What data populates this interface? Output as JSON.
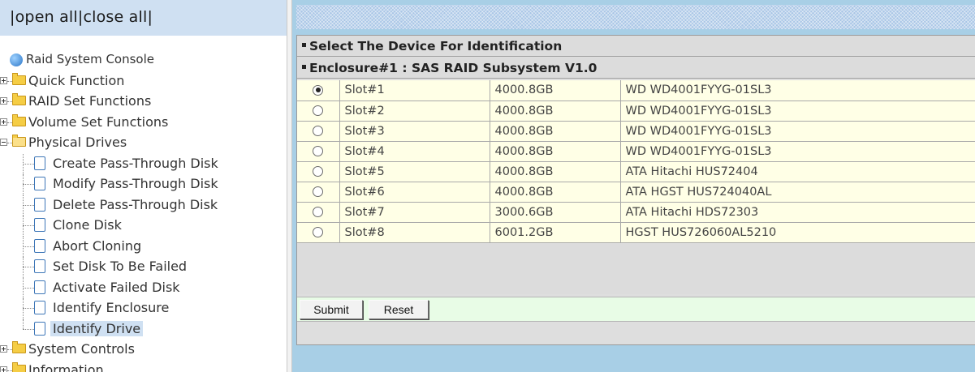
{
  "top_links": {
    "prefix": "|",
    "open_all": "open all",
    "sep": "|",
    "close_all": "close all",
    "suffix": "|"
  },
  "tree": {
    "root": "Raid System Console",
    "folders_before": [
      "Quick Function",
      "RAID Set Functions",
      "Volume Set Functions"
    ],
    "open_folder": "Physical Drives",
    "leaves": [
      "Create Pass-Through Disk",
      "Modify Pass-Through Disk",
      "Delete Pass-Through Disk",
      "Clone Disk",
      "Abort Cloning",
      "Set Disk To Be Failed",
      "Activate Failed Disk",
      "Identify Enclosure",
      "Identify Drive"
    ],
    "selected_leaf": "Identify Drive",
    "folders_after": [
      "System Controls",
      "Information"
    ]
  },
  "panel": {
    "title": "Select The Device For Identification",
    "enclosure": "Enclosure#1 : SAS RAID Subsystem V1.0",
    "drives": [
      {
        "slot": "Slot#1",
        "size": "4000.8GB",
        "model": "WD WD4001FYYG-01SL3",
        "selected": true
      },
      {
        "slot": "Slot#2",
        "size": "4000.8GB",
        "model": "WD WD4001FYYG-01SL3",
        "selected": false
      },
      {
        "slot": "Slot#3",
        "size": "4000.8GB",
        "model": "WD WD4001FYYG-01SL3",
        "selected": false
      },
      {
        "slot": "Slot#4",
        "size": "4000.8GB",
        "model": "WD WD4001FYYG-01SL3",
        "selected": false
      },
      {
        "slot": "Slot#5",
        "size": "4000.8GB",
        "model": "ATA Hitachi HUS72404",
        "selected": false
      },
      {
        "slot": "Slot#6",
        "size": "4000.8GB",
        "model": "ATA HGST HUS724040AL",
        "selected": false
      },
      {
        "slot": "Slot#7",
        "size": "3000.6GB",
        "model": "ATA Hitachi HDS72303",
        "selected": false
      },
      {
        "slot": "Slot#8",
        "size": "6001.2GB",
        "model": "HGST HUS726060AL5210",
        "selected": false
      }
    ],
    "submit_label": "Submit",
    "reset_label": "Reset"
  },
  "colors": {
    "tree_header_bg": "#cfe0f2",
    "right_bg": "#a8cfe6",
    "header_bg": "#dcdcdc",
    "row_bg": "#ffffe6",
    "button_bar_bg": "#e8fce6",
    "selected_leaf_bg": "#cfe0f2"
  }
}
